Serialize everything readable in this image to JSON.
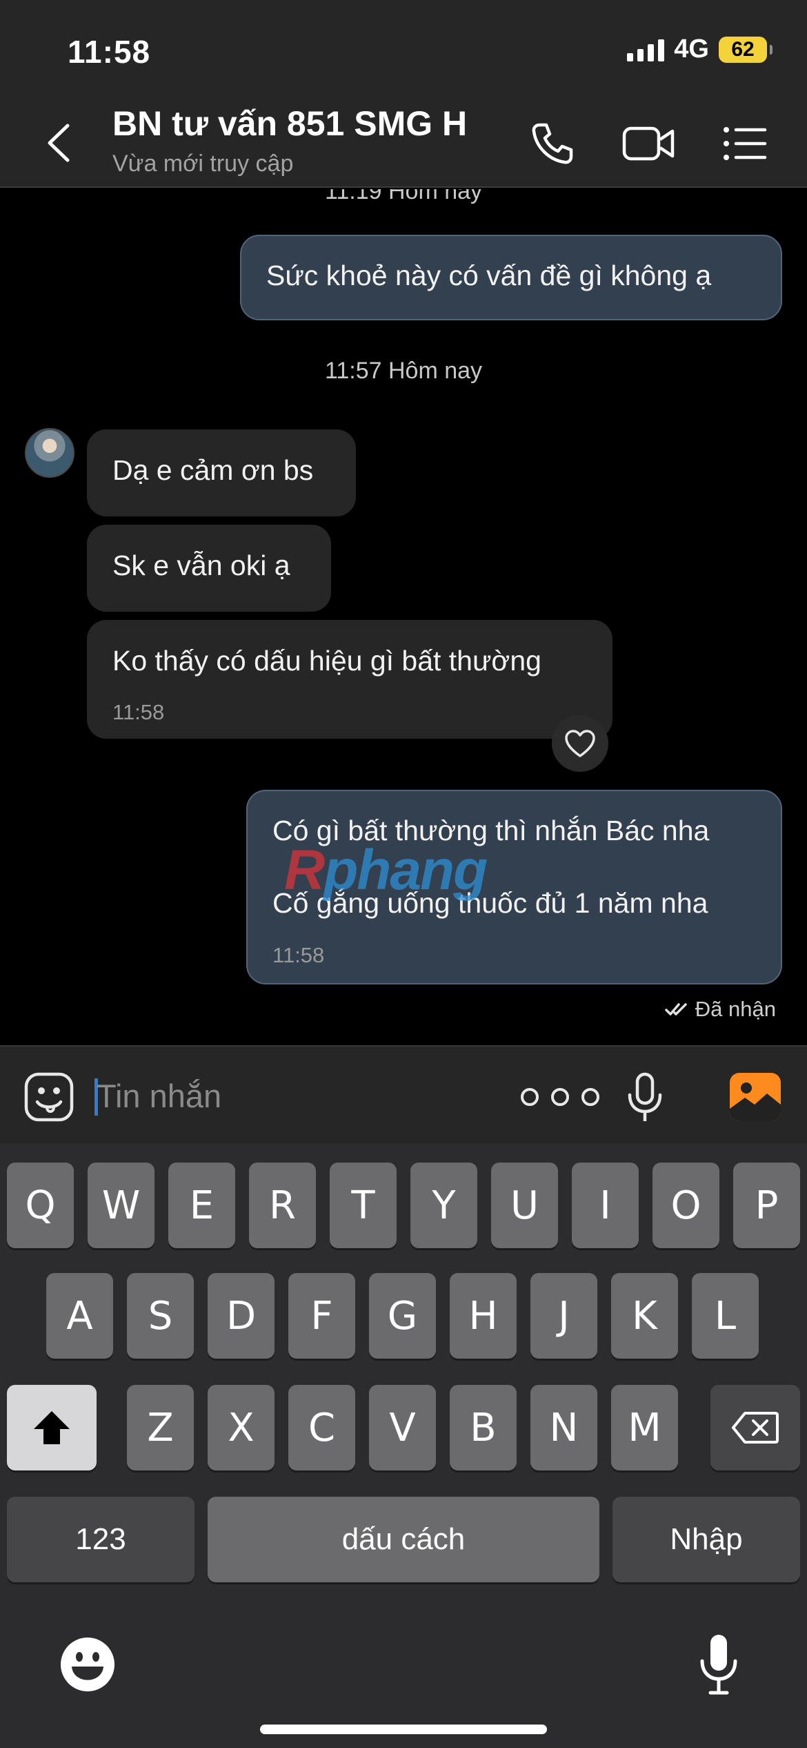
{
  "status_bar": {
    "time": "11:58",
    "network": "4G",
    "battery": "62"
  },
  "header": {
    "title": "BN tư vấn 851 SMG H",
    "subtitle": "Vừa mới truy cập"
  },
  "messages": {
    "timestamp_top": "11:19 Hôm nay",
    "out_1": "Sức khoẻ này có vấn đề gì không ạ",
    "timestamp_mid": "11:57 Hôm nay",
    "in_1": "Dạ e cảm ơn bs",
    "in_2": "Sk e vẫn oki ạ",
    "in_3": "Ko thấy có dấu hiệu gì bất thường",
    "in_3_time": "11:58",
    "out_2_line1": "Có gì bất thường thì nhắn Bác nha",
    "out_2_line2": "Cố gắng uống thuốc đủ 1 năm nha",
    "out_2_time": "11:58",
    "read_status": "Đã nhận"
  },
  "watermark": {
    "text": "Rphang"
  },
  "input": {
    "placeholder": "Tin nhắn"
  },
  "keyboard": {
    "row1": [
      "Q",
      "W",
      "E",
      "R",
      "T",
      "Y",
      "U",
      "I",
      "O",
      "P"
    ],
    "row2": [
      "A",
      "S",
      "D",
      "F",
      "G",
      "H",
      "J",
      "K",
      "L"
    ],
    "row3": [
      "Z",
      "X",
      "C",
      "V",
      "B",
      "N",
      "M"
    ],
    "numbers_label": "123",
    "space_label": "dấu cách",
    "return_label": "Nhập"
  },
  "colors": {
    "accent_bubble": "#33404f",
    "battery": "#f3d23a",
    "gallery": "#ff8a1e",
    "caret": "#2f7fd1"
  },
  "icons": [
    "back-icon",
    "phone-icon",
    "video-icon",
    "menu-icon",
    "sticker-icon",
    "more-icon",
    "mic-icon",
    "gallery-icon",
    "heart-icon",
    "double-check-icon",
    "shift-icon",
    "delete-icon",
    "emoji-icon",
    "dictation-icon"
  ]
}
